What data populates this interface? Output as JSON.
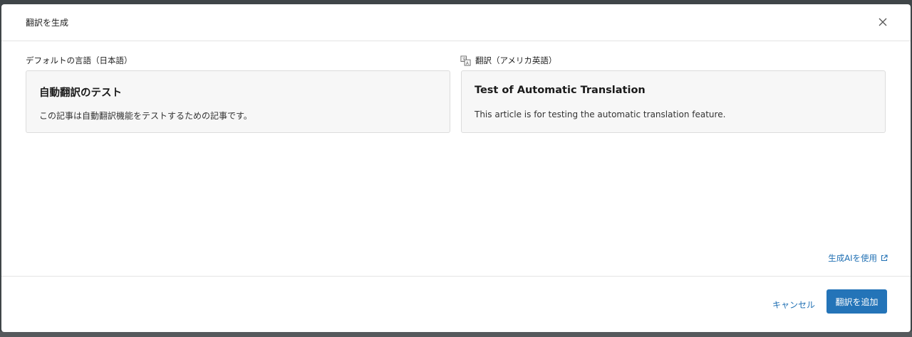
{
  "dialog": {
    "title": "翻訳を生成"
  },
  "source": {
    "label": "デフォルトの言語（日本語）",
    "title": "自動翻訳のテスト",
    "body": "この記事は自動翻訳機能をテストするための記事です。"
  },
  "translation": {
    "label": "翻訳（アメリカ英語）",
    "icon": "translate-icon",
    "title": "Test of Automatic Translation",
    "body": "This article is for testing the automatic translation feature."
  },
  "gen_ai_link": {
    "label": "生成AIを使用",
    "icon": "external-link-icon"
  },
  "footer": {
    "cancel_label": "キャンセル",
    "add_label": "翻訳を追加"
  },
  "colors": {
    "accent": "#2474b8",
    "link": "#1f6fb3",
    "card_bg": "#f7f7f7",
    "backdrop": "#3f4548"
  }
}
